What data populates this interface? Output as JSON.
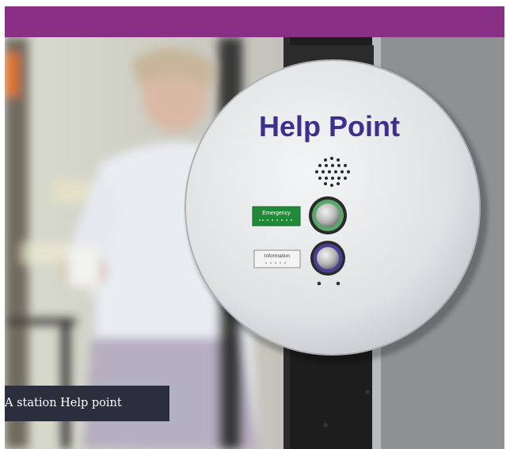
{
  "photo": {
    "sign_title": "Help Point",
    "emergency_label": "Emergency",
    "information_label": "Information",
    "colors": {
      "header_bar": "#8a2f86",
      "caption_bg": "#2b2f3d",
      "sign_text": "#3b2f8f",
      "emergency_plate": "#1f8a3a"
    }
  },
  "caption": {
    "text": "A station Help point"
  }
}
